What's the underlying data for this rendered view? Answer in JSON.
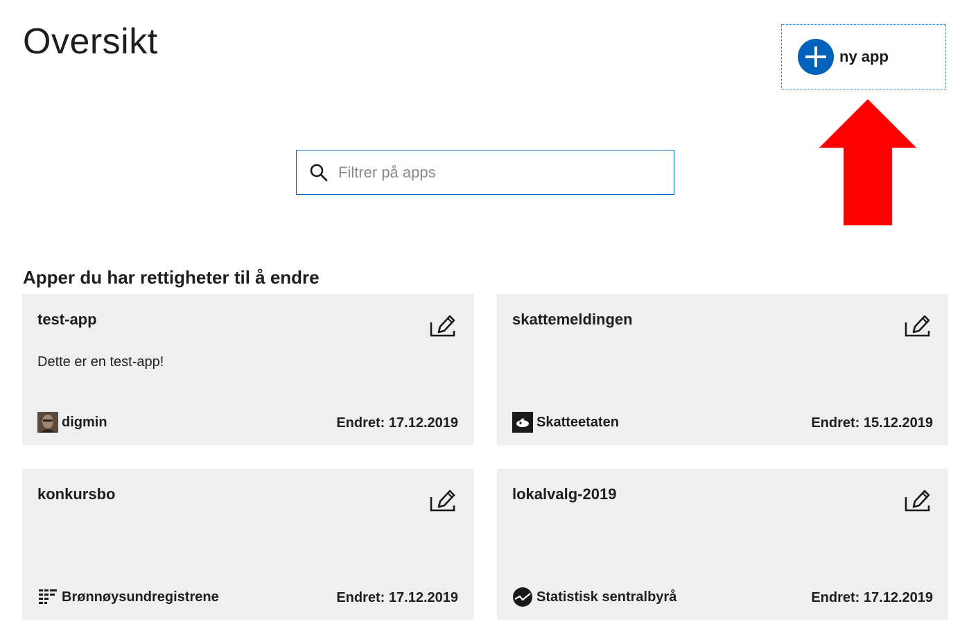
{
  "header": {
    "title": "Oversikt",
    "new_app_label": "ny app"
  },
  "search": {
    "placeholder": "Filtrer på apps",
    "value": ""
  },
  "section": {
    "heading": "Apper du har rettigheter til å endre"
  },
  "cards": [
    {
      "name": "test-app",
      "description": "Dette er en test-app!",
      "owner": "digmin",
      "owner_icon": "user-avatar",
      "changed": "Endret: 17.12.2019"
    },
    {
      "name": "skattemeldingen",
      "description": "",
      "owner": "Skatteetaten",
      "owner_icon": "skatteetaten-logo",
      "changed": "Endret: 15.12.2019"
    },
    {
      "name": "konkursbo",
      "description": "",
      "owner": "Brønnøysundregistrene",
      "owner_icon": "bronnoysund-logo",
      "changed": "Endret: 17.12.2019"
    },
    {
      "name": "lokalvalg-2019",
      "description": "",
      "owner": "Statistisk sentralbyrå",
      "owner_icon": "ssb-logo",
      "changed": "Endret: 17.12.2019"
    }
  ],
  "colors": {
    "accent": "#0062ba",
    "card_bg": "#efefef",
    "annotation_arrow": "#ff0000"
  }
}
